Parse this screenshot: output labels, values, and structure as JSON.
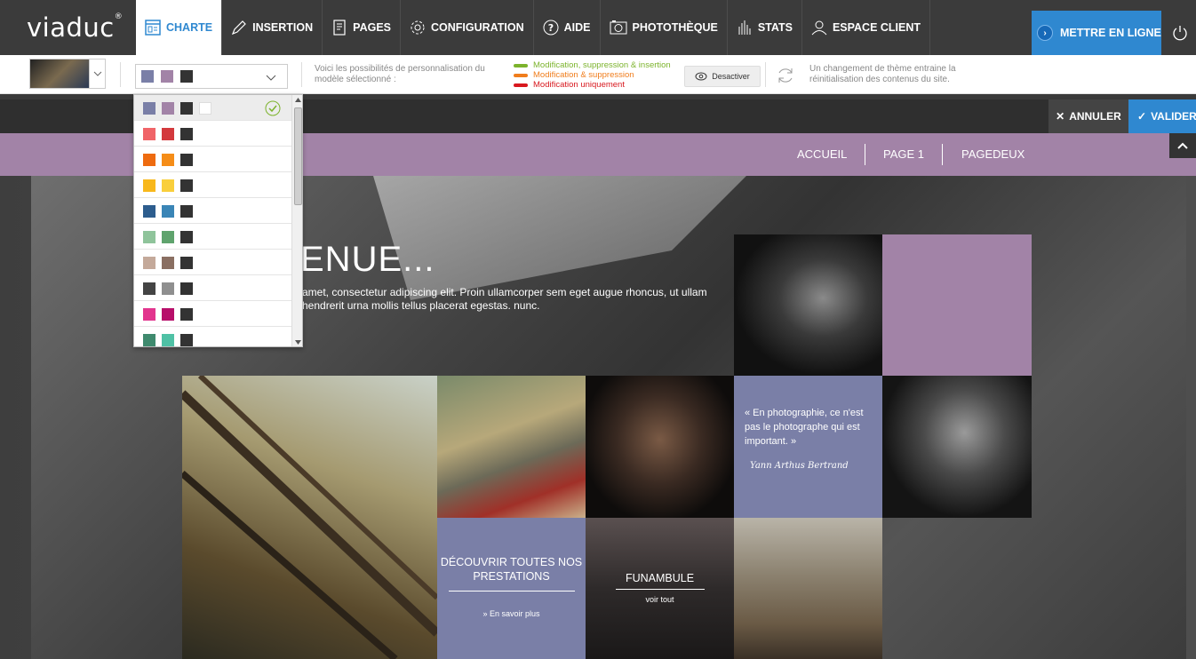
{
  "app": {
    "logo": "viaduc",
    "logo_mark": "®"
  },
  "nav": {
    "items": [
      {
        "label": "CHARTE",
        "icon": "layout-icon",
        "active": true
      },
      {
        "label": "INSERTION",
        "icon": "pencil-icon"
      },
      {
        "label": "PAGES",
        "icon": "pages-icon"
      },
      {
        "label": "CONFIGURATION",
        "icon": "gear-icon"
      },
      {
        "label": "AIDE",
        "icon": "help-icon"
      },
      {
        "label": "PHOTOTHÈQUE",
        "icon": "camera-icon"
      },
      {
        "label": "STATS",
        "icon": "stats-icon"
      },
      {
        "label": "ESPACE CLIENT",
        "icon": "user-icon"
      }
    ],
    "publish_label": "METTRE EN LIGNE"
  },
  "toolbar": {
    "info": "Voici les possibilités de personnalisation du modèle sélectionné :",
    "legend": [
      {
        "label": "Modification, suppression & insertion",
        "color": "#7cb32c"
      },
      {
        "label": "Modification & suppression",
        "color": "#f07d1c"
      },
      {
        "label": "Modification uniquement",
        "color": "#d8181e"
      }
    ],
    "deactivate_label": "Desactiver",
    "theme_notice": "Un changement de thème entraine la réinitialisation des contenus du site."
  },
  "selected_palette": [
    "#7a7fa7",
    "#a283a7",
    "#333333"
  ],
  "palettes": [
    {
      "colors": [
        "#7a7fa7",
        "#a283a7",
        "#333333",
        "#ffffff"
      ],
      "selected": true
    },
    {
      "colors": [
        "#f06468",
        "#d3393d",
        "#333333"
      ]
    },
    {
      "colors": [
        "#ee6b10",
        "#f58d18",
        "#333333"
      ]
    },
    {
      "colors": [
        "#f8b81c",
        "#f9cf3c",
        "#333333"
      ]
    },
    {
      "colors": [
        "#2d5d8e",
        "#3a85b6",
        "#333333"
      ]
    },
    {
      "colors": [
        "#8fc49b",
        "#5fa36d",
        "#333333"
      ]
    },
    {
      "colors": [
        "#c4a99a",
        "#8a6f62",
        "#333333"
      ]
    },
    {
      "colors": [
        "#444444",
        "#8f8f8f",
        "#333333"
      ]
    },
    {
      "colors": [
        "#e2358e",
        "#b70f6a",
        "#333333"
      ]
    },
    {
      "colors": [
        "#3f8a6e",
        "#4fc1a5",
        "#333333"
      ]
    }
  ],
  "editor": {
    "cancel_label": "ANNULER",
    "validate_label": "VALIDER"
  },
  "site": {
    "menu": [
      "ACCUEIL",
      "PAGE 1",
      "PAGEDEUX"
    ],
    "hero_title": "ENUE...",
    "hero_text": "amet, consectetur adipiscing elit. Proin ullamcorper sem eget augue rhoncus, ut ullam hendrerit urna mollis tellus placerat egestas. nunc.",
    "quote": "« En photographie, ce n'est pas le photographe qui est important. »",
    "quote_signature": "Yann Arthus Bertrand",
    "cta_title": "DÉCOUVRIR TOUTES NOS PRESTATIONS",
    "cta_link": "» En savoir plus",
    "tile_title": "FUNAMBULE",
    "tile_link": "voir tout",
    "accent": "#a283a7",
    "accent2": "#7a7fa7"
  }
}
